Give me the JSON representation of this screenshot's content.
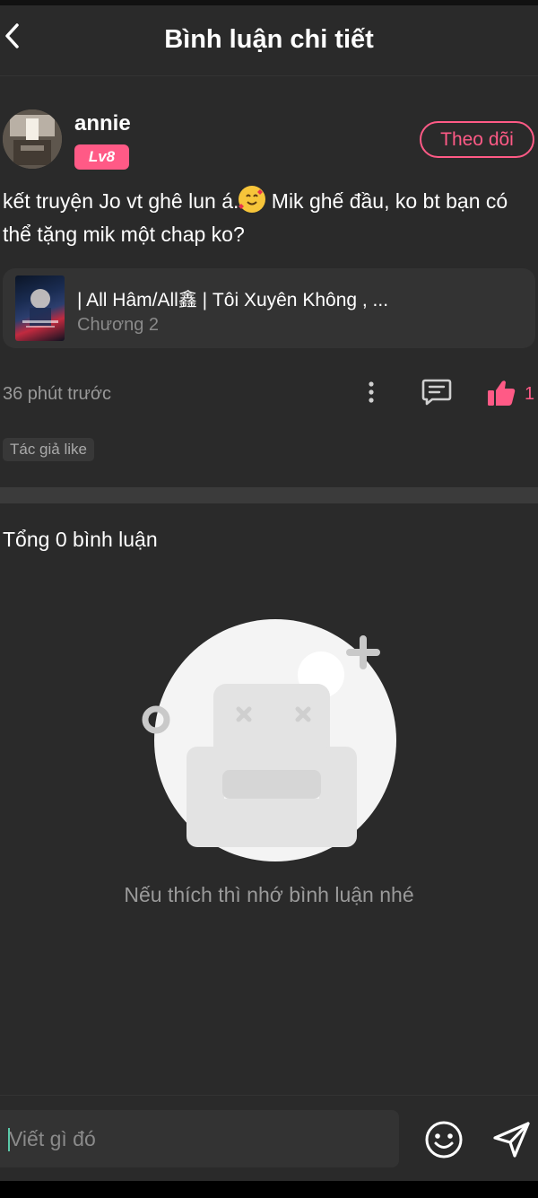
{
  "header": {
    "title": "Bình luận chi tiết"
  },
  "comment": {
    "username": "annie",
    "level": "Lv8",
    "follow_label": "Theo dõi",
    "text_part1": "kết truyện Jo vt ghê lun á.",
    "text_part2": " Mik ghế đầu, ko bt bạn có thể tặng mik một chap ko?",
    "time": "36 phút trước",
    "like_count": "1",
    "author_tag": "Tác giả like"
  },
  "story": {
    "title": "| All Hâm/All鑫 | Tôi Xuyên Không , ...",
    "chapter": "Chương 2"
  },
  "replies": {
    "total_label": "Tổng 0 bình luận",
    "empty_text": "Nếu thích thì nhớ bình luận nhé"
  },
  "input": {
    "placeholder": "Viết gì đó"
  },
  "colors": {
    "accent": "#ff5a86",
    "background": "#2a2a2a",
    "card": "#333333"
  },
  "icons": [
    "back-icon",
    "more-icon",
    "reply-icon",
    "like-icon",
    "emoji-icon",
    "send-icon"
  ]
}
